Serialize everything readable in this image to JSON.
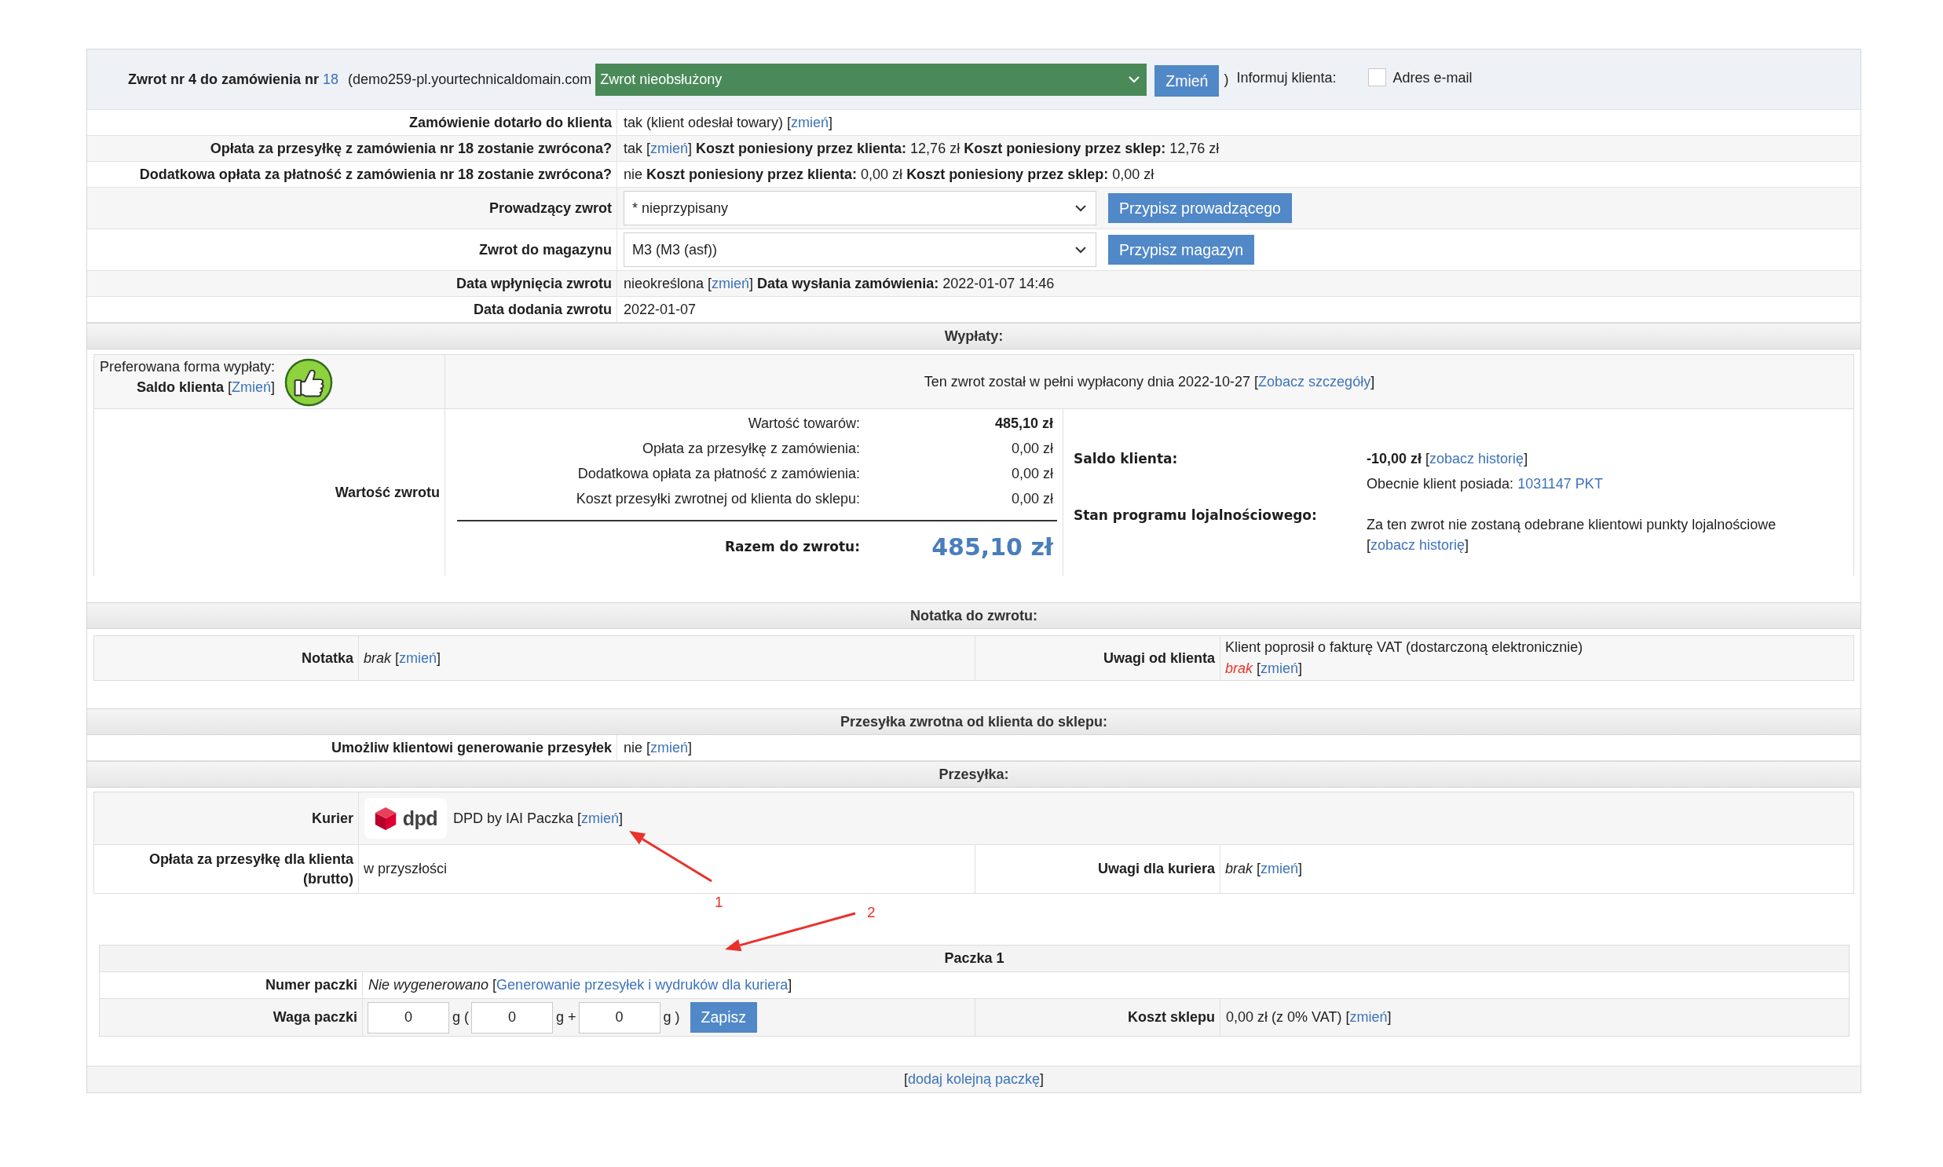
{
  "header": {
    "title": "Zwrot nr 4 do zamówienia nr",
    "order_number": "18",
    "domain": "(demo259-pl.yourtechnicaldomain.com",
    "status": "Zwrot nieobsłużony",
    "change_button": "Zmień",
    "closing": ")",
    "notify_label": "Informuj klienta:",
    "notify_options": [
      {
        "label": "Adres e-mail",
        "checked": false
      }
    ]
  },
  "details": [
    {
      "kind": "text",
      "label": "Zamówienie dotarło do klienta",
      "segments": [
        {
          "kind": "text",
          "text": "tak (klient odesłał towary) ["
        },
        {
          "kind": "link",
          "text": "zmień"
        },
        {
          "kind": "text",
          "text": "]"
        }
      ]
    },
    {
      "kind": "text",
      "label": "Opłata za przesyłkę z zamówienia nr 18 zostanie zwrócona?",
      "segments": [
        {
          "kind": "text",
          "text": "tak ["
        },
        {
          "kind": "link",
          "text": "zmień"
        },
        {
          "kind": "text",
          "text": "] **Koszt poniesiony przez klienta:** 12,76 zł **Koszt poniesiony przez sklep:** 12,76 zł"
        }
      ]
    },
    {
      "kind": "text",
      "label": "Dodatkowa opłata za płatność z zamówienia nr 18 zostanie zwrócona?",
      "segments": [
        {
          "kind": "text",
          "text": "nie **Koszt poniesiony przez klienta:** 0,00 zł **Koszt poniesiony przez sklep:** 0,00 zł"
        }
      ]
    },
    {
      "kind": "select",
      "label": "Prowadzący zwrot",
      "value": "* nieprzypisany",
      "button": "Przypisz prowadzącego"
    },
    {
      "kind": "select",
      "label": "Zwrot do magazynu",
      "value": "M3 (M3 (asf))",
      "button": "Przypisz magazyn"
    },
    {
      "kind": "text",
      "label": "Data wpłynięcia zwrotu",
      "segments": [
        {
          "kind": "text",
          "text": "nieokreślona ["
        },
        {
          "kind": "link",
          "text": "zmień"
        },
        {
          "kind": "text",
          "text": "] **Data wysłania zamówienia:** 2022-01-07 14:46"
        }
      ]
    },
    {
      "kind": "text",
      "label": "Data dodania zwrotu",
      "segments": [
        {
          "kind": "text",
          "text": "2022-01-07"
        }
      ]
    }
  ],
  "payouts": {
    "heading": "Wypłaty:",
    "preferred_label": "Preferowana forma wypłaty:",
    "preferred": [
      {
        "kind": "text",
        "text": "**Saldo klienta** ["
      },
      {
        "kind": "link",
        "text": "Zmień"
      },
      {
        "kind": "text",
        "text": "]"
      }
    ],
    "status": [
      {
        "kind": "text",
        "text": "Ten zwrot został w pełni wypłacony dnia 2022-10-27 ["
      },
      {
        "kind": "link",
        "text": "Zobacz szczegóły"
      },
      {
        "kind": "text",
        "text": "]"
      }
    ],
    "value_label": "Wartość zwrotu",
    "breakdown": [
      {
        "label": "Wartość towarów:",
        "amount": "485,10 zł",
        "bold": true
      },
      {
        "label": "Opłata za przesyłkę z zamówienia:",
        "amount": "0,00 zł",
        "bold": false
      },
      {
        "label": "Dodatkowa opłata za płatność z zamówienia:",
        "amount": "0,00 zł",
        "bold": false
      },
      {
        "label": "Koszt przesyłki zwrotnej od klienta do sklepu:",
        "amount": "0,00 zł",
        "bold": false
      }
    ],
    "total_label": "Razem do zwrotu:",
    "total": "485,10 zł",
    "balance_label": "Saldo klienta:",
    "balance": [
      {
        "kind": "text",
        "text": "**-10,00 zł** ["
      },
      {
        "kind": "link",
        "text": "zobacz historię"
      },
      {
        "kind": "text",
        "text": "]"
      }
    ],
    "points": [
      {
        "kind": "text",
        "text": "Obecnie klient posiada: "
      },
      {
        "kind": "link",
        "text": "1031147 PKT"
      }
    ],
    "loyalty_label": "Stan programu lojalnościowego:",
    "loyalty": [
      {
        "kind": "text",
        "text": "Za ten zwrot nie zostaną odebrane klientowi punkty lojalnościowe ["
      },
      {
        "kind": "link",
        "text": "zobacz historię"
      },
      {
        "kind": "text",
        "text": "]"
      }
    ]
  },
  "notes": {
    "heading": "Notatka do zwrotu:",
    "fields": [
      {
        "label": "Notatka",
        "segments": [
          {
            "kind": "empty",
            "text": "brak"
          },
          {
            "kind": "text",
            "text": " ["
          },
          {
            "kind": "link",
            "text": "zmień"
          },
          {
            "kind": "text",
            "text": "]"
          }
        ]
      },
      {
        "label": "Uwagi od klienta",
        "message": "Klient poprosił o fakturę VAT (dostarczoną elektronicznie)",
        "segments": [
          {
            "kind": "alert",
            "text": "brak"
          },
          {
            "kind": "text",
            "text": " ["
          },
          {
            "kind": "link",
            "text": "zmień"
          },
          {
            "kind": "text",
            "text": "]"
          }
        ]
      }
    ]
  },
  "return_shipment": {
    "heading": "Przesyłka zwrotna od klienta do sklepu:",
    "rows": [
      {
        "label": "Umożliw klientowi generowanie przesyłek",
        "segments": [
          {
            "kind": "text",
            "text": "nie ["
          },
          {
            "kind": "link",
            "text": "zmień"
          },
          {
            "kind": "text",
            "text": "]"
          }
        ]
      }
    ]
  },
  "shipment": {
    "heading": "Przesyłka:",
    "courier_label": "Kurier",
    "logo_text": "dpd",
    "courier": [
      {
        "kind": "text",
        "text": "DPD by IAI Paczka ["
      },
      {
        "kind": "link",
        "text": "zmień"
      },
      {
        "kind": "text",
        "text": "]"
      }
    ],
    "fee_label": "Opłata za przesyłkę dla klienta (brutto)",
    "fee": "w przyszłości",
    "notes_label": "Uwagi dla kuriera",
    "notes": [
      {
        "kind": "empty",
        "text": "brak"
      },
      {
        "kind": "text",
        "text": " ["
      },
      {
        "kind": "link",
        "text": "zmień"
      },
      {
        "kind": "text",
        "text": "]"
      }
    ]
  },
  "annotations": [
    {
      "label": "1"
    },
    {
      "label": "2"
    }
  ],
  "package": {
    "title": "Paczka 1",
    "number_label": "Numer paczki",
    "number": [
      {
        "kind": "empty",
        "text": "Nie wygenerowano"
      },
      {
        "kind": "text",
        "text": " ["
      },
      {
        "kind": "link",
        "text": "Generowanie przesyłek i wydruków dla kuriera"
      },
      {
        "kind": "text",
        "text": "]"
      }
    ],
    "weight_label": "Waga paczki",
    "weights": [
      {
        "value": "0",
        "unit": "g ("
      },
      {
        "value": "0",
        "unit": "g +"
      },
      {
        "value": "0",
        "unit": "g )"
      }
    ],
    "save_button": "Zapisz",
    "cost_label": "Koszt sklepu",
    "cost": [
      {
        "kind": "text",
        "text": "0,00 zł (z 0% VAT) ["
      },
      {
        "kind": "link",
        "text": "zmień"
      },
      {
        "kind": "text",
        "text": "]"
      }
    ]
  },
  "footer": {
    "segments": [
      {
        "kind": "text",
        "text": "["
      },
      {
        "kind": "link",
        "text": "dodaj kolejną paczkę"
      },
      {
        "kind": "text",
        "text": "]"
      }
    ]
  }
}
